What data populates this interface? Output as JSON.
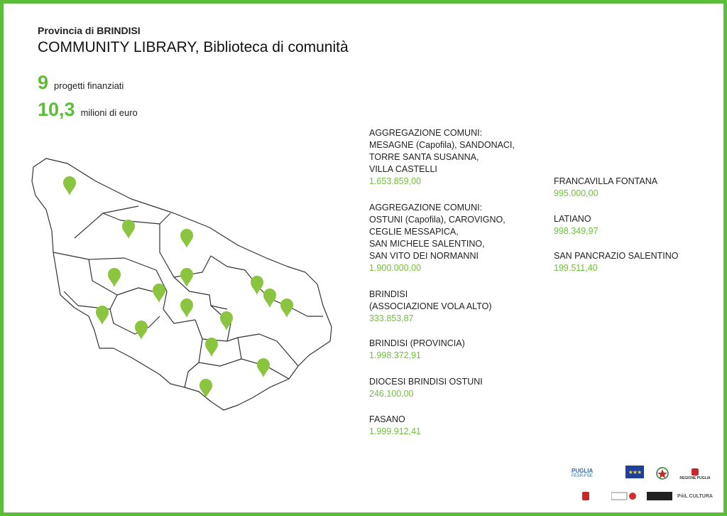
{
  "header": {
    "province": "Provincia di BRINDISI",
    "title": "COMMUNITY LIBRARY, Biblioteca di comunità"
  },
  "stats": [
    {
      "value": "9",
      "label": "progetti finanziati"
    },
    {
      "value": "10,3",
      "label": "milioni di euro"
    }
  ],
  "colors": {
    "accent": "#5cbd3b",
    "amount": "#6fbf3a",
    "border": "#5cbd3b"
  },
  "map": {
    "marker_icon": "map-pin-icon",
    "marker_count": 14
  },
  "projects_left": [
    {
      "name": "AGGREGAZIONE COMUNI:\nMESAGNE (Capofila), SANDONACI,\nTORRE SANTA SUSANNA,\nVILLA CASTELLI",
      "amount": "1.653.859,00"
    },
    {
      "name": "AGGREGAZIONE COMUNI:\nOSTUNI (Capofila), CAROVIGNO,\nCEGLIE MESSAPICA,\nSAN MICHELE SALENTINO,\nSAN VITO DEI NORMANNI",
      "amount": "1.900.000,00"
    },
    {
      "name": "BRINDISI\n(ASSOCIAZIONE VOLA ALTO)",
      "amount": "333.853,87"
    },
    {
      "name": "BRINDISI (PROVINCIA)",
      "amount": "1.998.372,91"
    },
    {
      "name": "DIOCESI BRINDISI OSTUNI",
      "amount": "246.100,00"
    },
    {
      "name": "FASANO",
      "amount": "1.999.912,41"
    }
  ],
  "projects_right": [
    {
      "name": "FRANCAVILLA FONTANA",
      "amount": "995.000,00"
    },
    {
      "name": "LATIANO",
      "amount": "998.349,97"
    },
    {
      "name": "SAN PANCRAZIO SALENTINO",
      "amount": "199.511,40"
    }
  ],
  "logos": {
    "puglia_fesr": "PUGLIA",
    "puglia_fesr_sub": "FESR-FSE",
    "regione_puglia": "REGIONE PUGLIA",
    "piil_cultura": "PiiiL CULTURA"
  }
}
